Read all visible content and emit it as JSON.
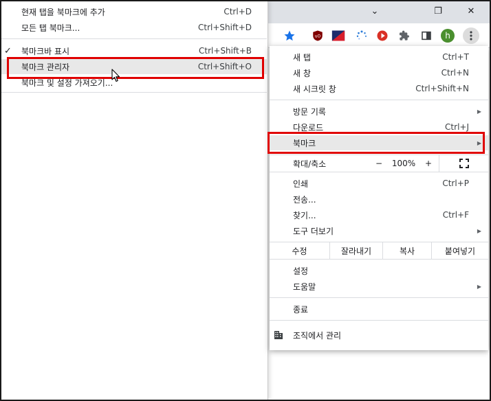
{
  "browser": {
    "window_controls": {
      "minimize": "⌄",
      "restore": "❐",
      "close": "✕"
    },
    "toolbar_icons": [
      "star-icon",
      "ublock-icon",
      "flag-extension-icon",
      "loading-extension-icon",
      "play-extension-icon",
      "extensions-puzzle-icon",
      "sidepanel-icon",
      "profile-avatar",
      "more-menu-icon"
    ],
    "star_color": "#1a73e8",
    "profile_initial": "h",
    "profile_color": "#4a8f2e"
  },
  "bookmarks_submenu": {
    "items": [
      {
        "label": "현재 탭을 북마크에 추가",
        "shortcut": "Ctrl+D"
      },
      {
        "label": "모든 탭 북마크...",
        "shortcut": "Ctrl+Shift+D"
      },
      {
        "label": "북마크바 표시",
        "shortcut": "Ctrl+Shift+B",
        "checked": true
      },
      {
        "label": "북마크 관리자",
        "shortcut": "Ctrl+Shift+O"
      },
      {
        "label": "북마크 및 설정 가져오기...",
        "shortcut": ""
      }
    ]
  },
  "main_menu": {
    "new_tab": {
      "label": "새 탭",
      "shortcut": "Ctrl+T"
    },
    "new_window": {
      "label": "새 창",
      "shortcut": "Ctrl+N"
    },
    "incognito": {
      "label": "새 시크릿 창",
      "shortcut": "Ctrl+Shift+N"
    },
    "history": {
      "label": "방문 기록"
    },
    "downloads": {
      "label": "다운로드",
      "shortcut": "Ctrl+J"
    },
    "bookmarks": {
      "label": "북마크"
    },
    "zoom": {
      "label": "확대/축소",
      "minus": "−",
      "value": "100%",
      "plus": "+",
      "fullscreen": "⛶"
    },
    "print": {
      "label": "인쇄",
      "shortcut": "Ctrl+P"
    },
    "cast": {
      "label": "전송..."
    },
    "find": {
      "label": "찾기...",
      "shortcut": "Ctrl+F"
    },
    "more_tools": {
      "label": "도구 더보기"
    },
    "edit": {
      "label": "수정",
      "cut": "잘라내기",
      "copy": "복사",
      "paste": "붙여넣기"
    },
    "settings": {
      "label": "설정"
    },
    "help": {
      "label": "도움말"
    },
    "exit": {
      "label": "종료"
    },
    "managed": {
      "label": "조직에서 관리"
    }
  },
  "colors": {
    "highlight_border": "#e00000",
    "hover_bg": "#e8e8e8"
  }
}
